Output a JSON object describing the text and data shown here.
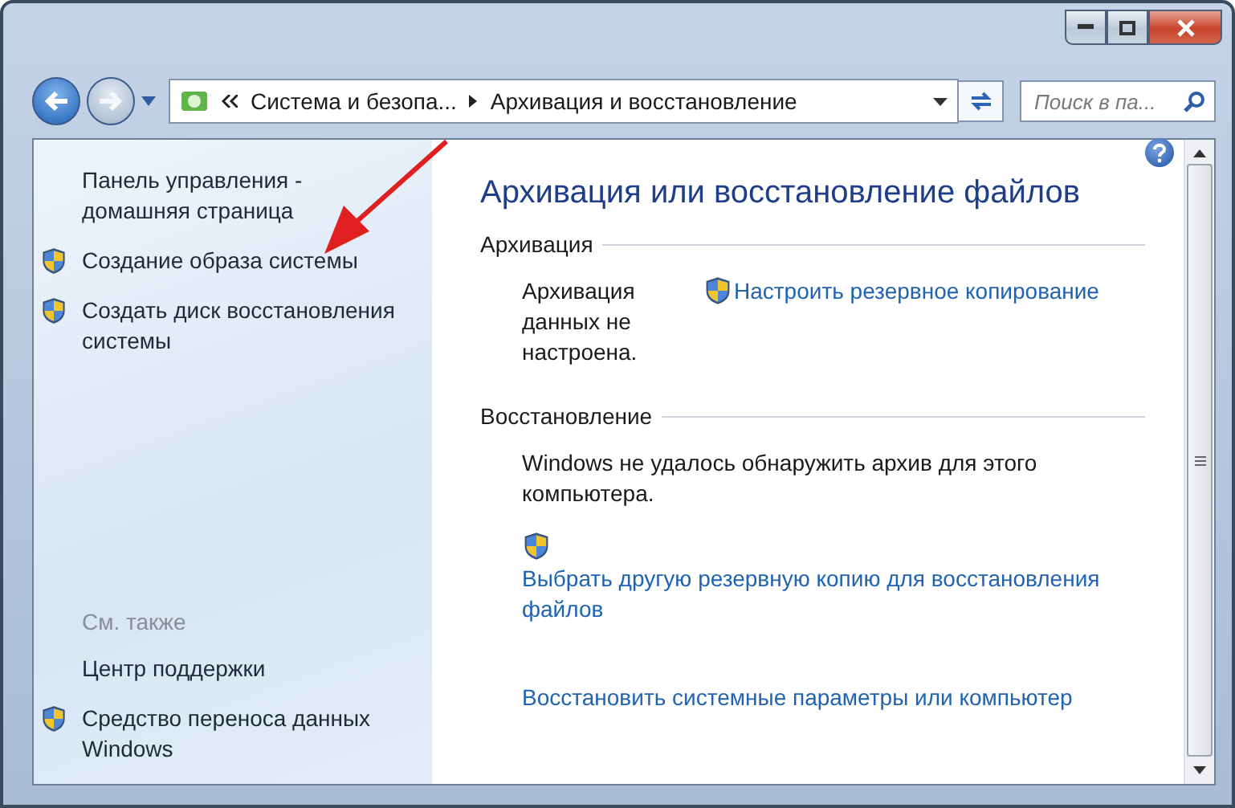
{
  "address_bar": {
    "breadcrumbs": [
      "Система и безопа...",
      "Архивация и восстановление"
    ]
  },
  "search": {
    "placeholder": "Поиск в па..."
  },
  "sidebar": {
    "links": [
      {
        "text": "Панель управления - домашняя страница",
        "kind": "plain"
      },
      {
        "text": "Создание образа системы",
        "kind": "shield"
      },
      {
        "text": "Создать диск восстановления системы",
        "kind": "shield"
      }
    ],
    "see_also_label": "См. также",
    "see_also": [
      {
        "text": "Центр поддержки",
        "kind": "plain"
      },
      {
        "text": "Средство переноса данных Windows",
        "kind": "shield"
      }
    ]
  },
  "main": {
    "title": "Архивация или восстановление файлов",
    "sections": [
      {
        "heading": "Архивация",
        "status": "Архивация данных не настроена.",
        "links": [
          {
            "text": "Настроить резервное копирование",
            "kind": "shield-inline"
          }
        ]
      },
      {
        "heading": "Восстановление",
        "status": "Windows не удалось обнаружить архив для этого компьютера.",
        "links": [
          {
            "text": "Выбрать другую резервную копию для восстановления файлов",
            "kind": "shield-above"
          },
          {
            "text": "Восстановить системные параметры или компьютер",
            "kind": "plain"
          }
        ]
      }
    ]
  }
}
